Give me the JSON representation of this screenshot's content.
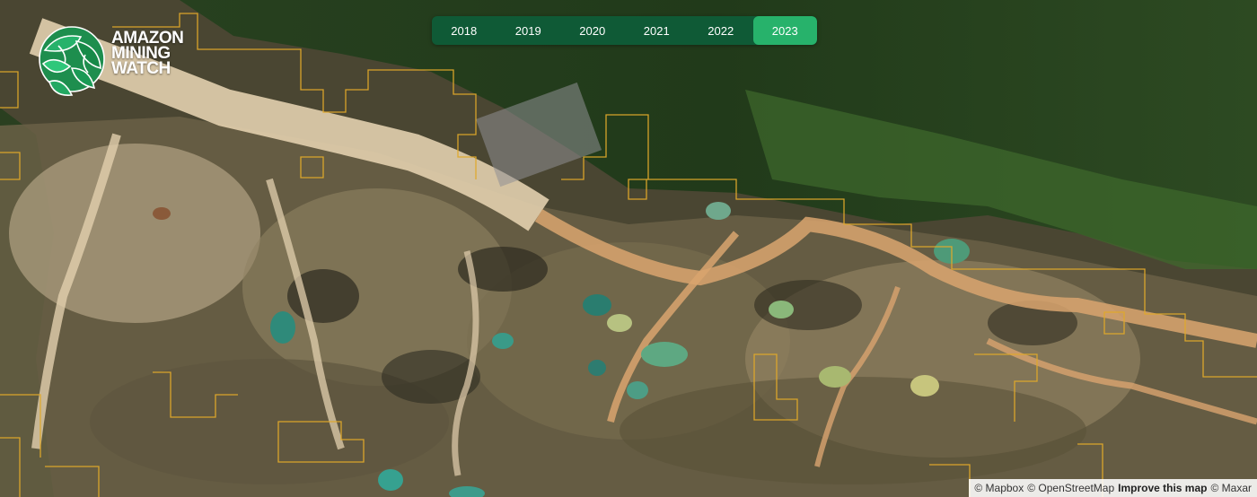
{
  "brand": {
    "line1": "AMAZON",
    "line2": "MINING",
    "line3": "WATCH"
  },
  "years": [
    {
      "label": "2018",
      "active": false
    },
    {
      "label": "2019",
      "active": false
    },
    {
      "label": "2020",
      "active": false
    },
    {
      "label": "2021",
      "active": false
    },
    {
      "label": "2022",
      "active": false
    },
    {
      "label": "2023",
      "active": true
    }
  ],
  "attribution": {
    "mapbox": "© Mapbox",
    "osm": "© OpenStreetMap",
    "improve": "Improve this map",
    "maxar": "© Maxar"
  },
  "colors": {
    "toggle_bg": "#0f5a36",
    "toggle_active": "#27b26b",
    "concession_outline": "#e0a92a",
    "forest": "#1f3a18",
    "mining_sand": "#d8c3a0",
    "river": "#d9a46f"
  }
}
